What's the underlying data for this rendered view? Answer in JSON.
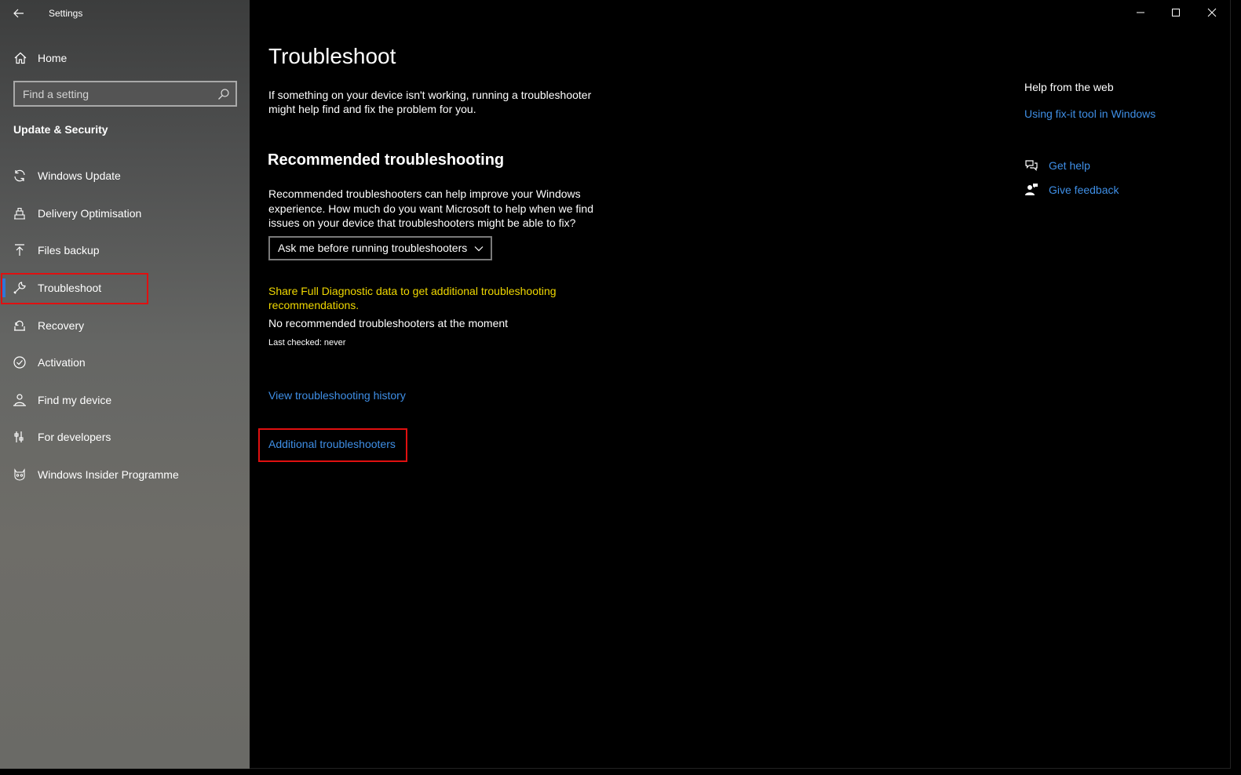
{
  "window": {
    "title": "Settings"
  },
  "sidebar": {
    "home_label": "Home",
    "search_placeholder": "Find a setting",
    "section_title": "Update & Security",
    "items": [
      {
        "label": "Windows Update",
        "icon": "sync-icon"
      },
      {
        "label": "Delivery Optimisation",
        "icon": "delivery-optimisation-icon"
      },
      {
        "label": "Files backup",
        "icon": "upload-arrow-icon"
      },
      {
        "label": "Troubleshoot",
        "icon": "wrench-icon",
        "active": true
      },
      {
        "label": "Recovery",
        "icon": "recovery-icon"
      },
      {
        "label": "Activation",
        "icon": "check-circle-icon"
      },
      {
        "label": "Find my device",
        "icon": "person-location-icon"
      },
      {
        "label": "For developers",
        "icon": "developer-sliders-icon"
      },
      {
        "label": "Windows Insider Programme",
        "icon": "insider-cat-icon"
      }
    ]
  },
  "main": {
    "title": "Troubleshoot",
    "intro": "If something on your device isn't working, running a troubleshooter might help find and fix the problem for you.",
    "recommended_heading": "Recommended troubleshooting",
    "recommended_desc": "Recommended troubleshooters can help improve your Windows experience. How much do you want Microsoft to help when we find issues on your device that troubleshooters might be able to fix?",
    "dropdown_value": "Ask me before running troubleshooters",
    "diagnostic_link": "Share Full Diagnostic data to get additional troubleshooting recommendations.",
    "no_recommended": "No recommended troubleshooters at the moment",
    "last_checked": "Last checked: never",
    "history_link": "View troubleshooting history",
    "additional_link": "Additional troubleshooters"
  },
  "help_panel": {
    "title": "Help from the web",
    "fixit_link": "Using fix-it tool in Windows",
    "get_help": "Get help",
    "give_feedback": "Give feedback"
  },
  "colors": {
    "accent": "#2f78d6",
    "link": "#3f8fe6",
    "warning": "#f0d800",
    "highlight": "#e01010"
  }
}
